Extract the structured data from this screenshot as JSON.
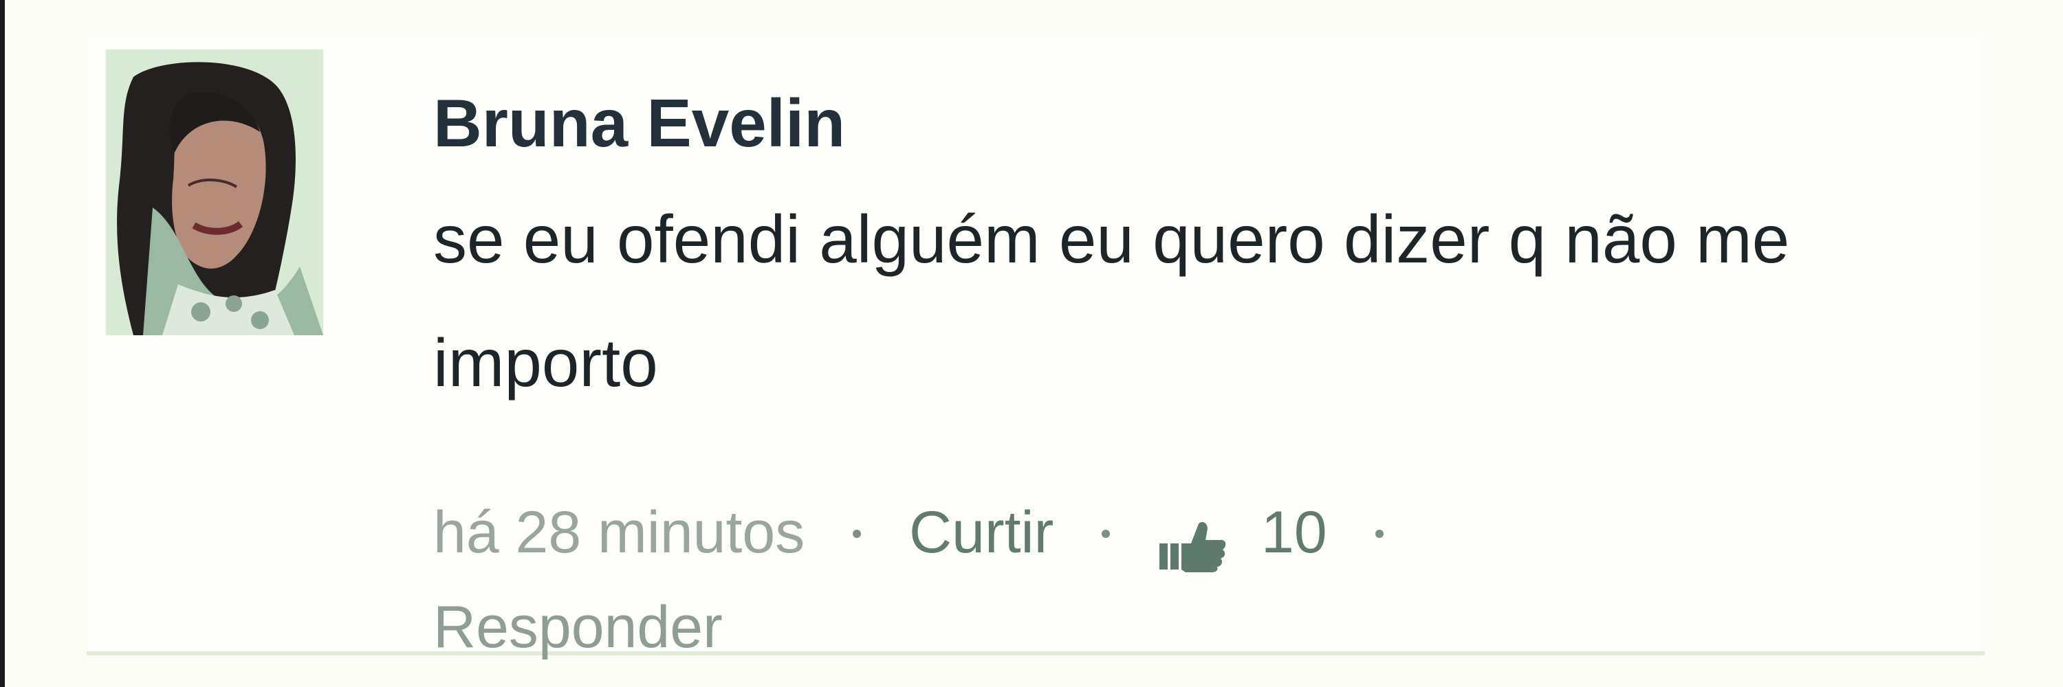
{
  "post": {
    "author": "Bruna Evelin",
    "comment": "se eu ofendi alguém eu quero dizer q não me importo",
    "time": "há 28 minutos",
    "like_label": "Curtir",
    "like_count": "10",
    "reply_label": "Responder"
  },
  "icons": {
    "like": "thumbs-up-icon",
    "dot": "separator-dot"
  },
  "colors": {
    "background": "#fbfdf6",
    "author_text": "#24313a",
    "comment_text": "#1d2529",
    "meta_text": "#8e9a93",
    "action_text": "#637a70"
  }
}
